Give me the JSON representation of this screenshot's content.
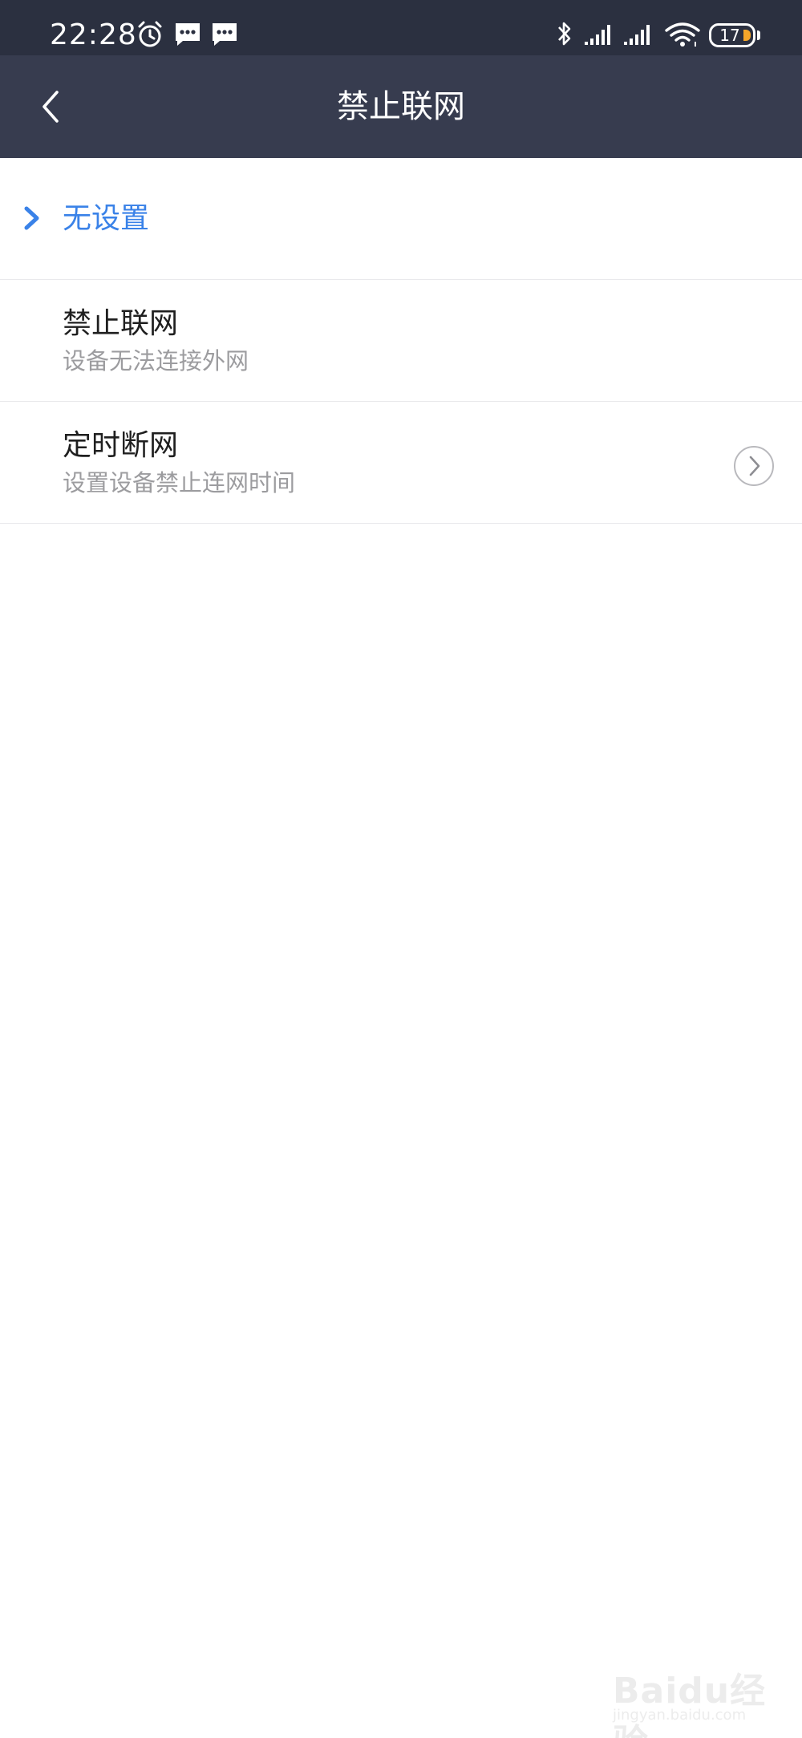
{
  "status_bar": {
    "time": "22:28",
    "left_icons": [
      "alarm-icon",
      "message-icon",
      "message-icon"
    ],
    "right_icons": [
      "bluetooth-icon",
      "signal-icon",
      "signal-icon",
      "wifi-icon"
    ],
    "battery_level": "17",
    "battery_accent_color": "#f4a62a"
  },
  "header": {
    "title": "禁止联网",
    "back_icon": "chevron-left-icon"
  },
  "options": [
    {
      "title": "无设置",
      "subtitle": "",
      "selected": true,
      "has_arrow": false
    },
    {
      "title": "禁止联网",
      "subtitle": "设备无法连接外网",
      "selected": false,
      "has_arrow": false
    },
    {
      "title": "定时断网",
      "subtitle": "设置设备禁止连网时间",
      "selected": false,
      "has_arrow": true
    }
  ],
  "colors": {
    "status_bar_bg": "#2b3040",
    "header_bg": "#373c4f",
    "selected_accent": "#3a82e8",
    "subtitle_text": "#9c9c9f"
  },
  "watermark": {
    "main": "Baidu经验",
    "sub": "jingyan.baidu.com"
  }
}
